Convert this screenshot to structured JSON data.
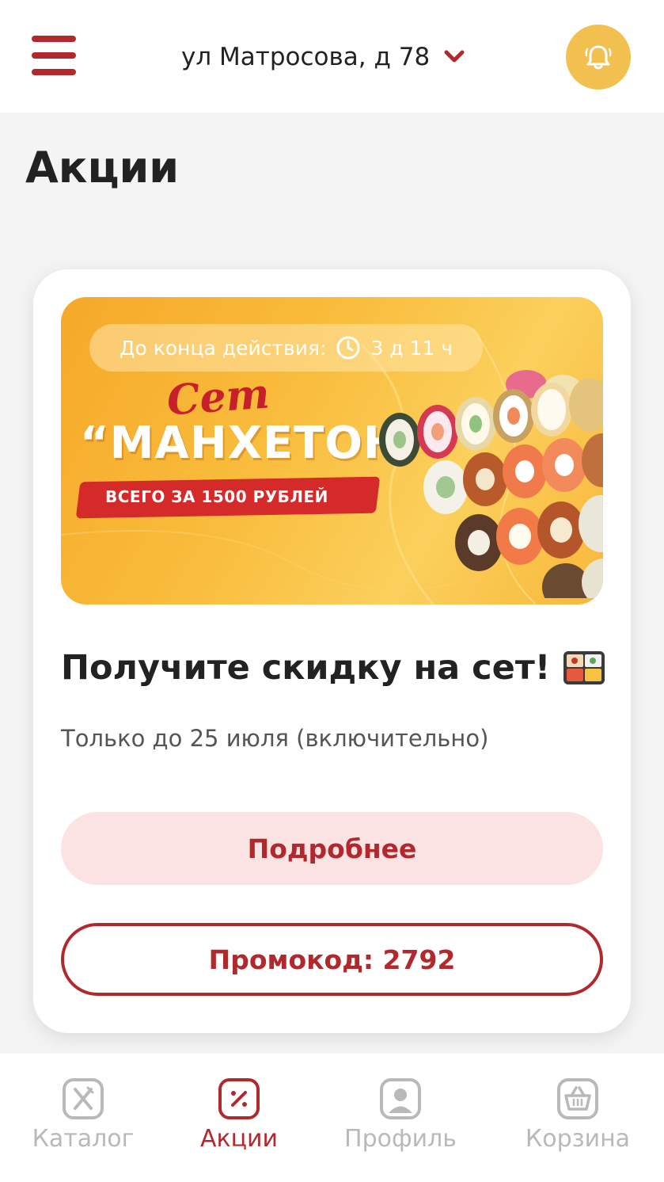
{
  "header": {
    "address": "ул Матросова, д 78"
  },
  "page": {
    "title": "Акции"
  },
  "promo": {
    "banner": {
      "timer_label": "До конца действия:",
      "timer_value": "3 д 11 ч",
      "set_word": "Сет",
      "set_name": "“МАНХЕТОН”",
      "price_text": "ВСЕГО ЗА 1500 РУБЛЕЙ"
    },
    "title": "Получите скидку на сет!",
    "subtitle": "Только до 25 июля (включительно)",
    "details_button": "Подробнее",
    "promocode_button": "Промокод: 2792"
  },
  "tabs": [
    {
      "label": "Каталог",
      "icon": "catalog-icon",
      "active": false
    },
    {
      "label": "Акции",
      "icon": "discount-icon",
      "active": true
    },
    {
      "label": "Профиль",
      "icon": "profile-icon",
      "active": false
    },
    {
      "label": "Корзина",
      "icon": "basket-icon",
      "active": false
    }
  ],
  "colors": {
    "accent": "#b2292d",
    "bell_bg": "#f2c04e",
    "details_bg": "#fbe3e3",
    "inactive_tab": "#b9b9b9"
  }
}
